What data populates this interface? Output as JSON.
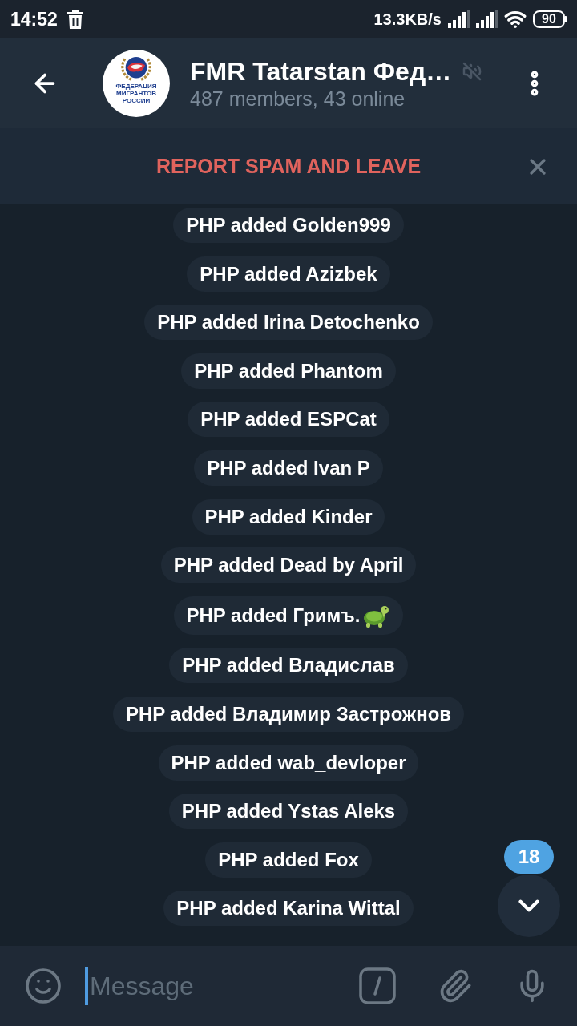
{
  "status_bar": {
    "time": "14:52",
    "speed": "13.3KB/s",
    "battery": "90"
  },
  "header": {
    "title": "FMR Tatarstan Фед…",
    "subtitle": "487 members, 43 online",
    "muted": true,
    "avatar_caption": "ФЕДЕРАЦИЯ МИГРАНТОВ РОССИИ"
  },
  "spam_bar": {
    "action": "REPORT SPAM AND LEAVE"
  },
  "messages": [
    {
      "kind": "text",
      "text": "PHP added Golden999"
    },
    {
      "kind": "text",
      "text": "PHP added Azizbek"
    },
    {
      "kind": "text",
      "text": "PHP added Irina Detochenko"
    },
    {
      "kind": "text",
      "text": "PHP added Phantom"
    },
    {
      "kind": "text",
      "text": "PHP added ESPCat"
    },
    {
      "kind": "text",
      "text": "PHP added Ivan P"
    },
    {
      "kind": "text",
      "text": "PHP added Kinder"
    },
    {
      "kind": "text",
      "text": "PHP added Dead by April"
    },
    {
      "kind": "emoji",
      "text": "PHP added Гримъ."
    },
    {
      "kind": "text",
      "text": "PHP added Владислав"
    },
    {
      "kind": "text",
      "text": "PHP added Владимир Застрожнов"
    },
    {
      "kind": "text",
      "text": "PHP added wab_devloper"
    },
    {
      "kind": "text",
      "text": "PHP added Ystas Aleks"
    },
    {
      "kind": "text",
      "text": "PHP added Fox"
    },
    {
      "kind": "text",
      "text": "PHP added Karina Wittal"
    }
  ],
  "scroll_button": {
    "unread": "18"
  },
  "composer": {
    "placeholder": "Message"
  }
}
